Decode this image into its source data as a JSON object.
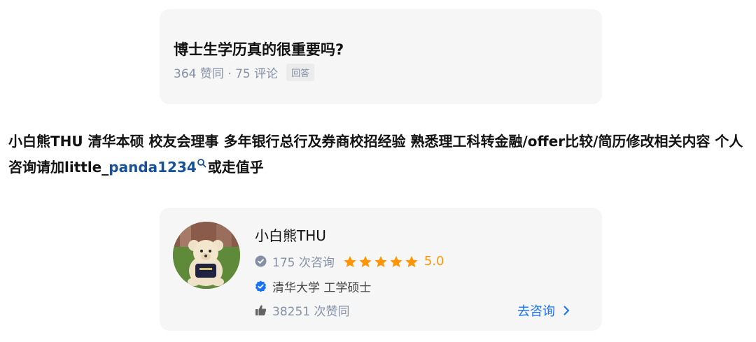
{
  "question": {
    "title": "博士生学历真的很重要吗?",
    "stats": "364 赞同 · 75 评论",
    "tag": "回答"
  },
  "bio": {
    "text_before": "小白熊THU 清华本硕 校友会理事 多年银行总行及券商校招经验 熟悉理工科转金融/offer比较/简历修改相关内容 个人咨询请加little_",
    "link": "panda1234",
    "text_after": "或走值乎"
  },
  "profile": {
    "name": "小白熊THU",
    "consult_count": "175 次咨询",
    "rating": "5.0",
    "stars": 5,
    "school": "清华大学 工学硕士",
    "likes": "38251 次赞同",
    "action": "去咨询"
  },
  "colors": {
    "link_blue": "#175199",
    "action_blue": "#1772f6",
    "star_orange": "#ff9607",
    "verified_blue": "#1772f6"
  }
}
